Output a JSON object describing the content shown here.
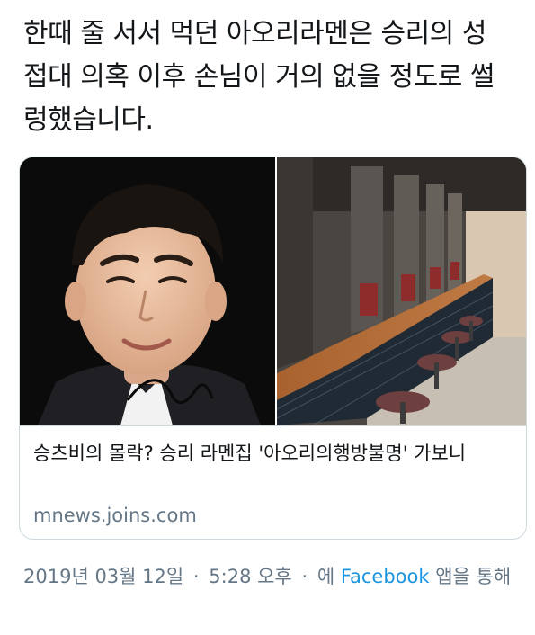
{
  "tweet": {
    "text": "한때 줄 서서 먹던 아오리라멘은 승리의 성 접대 의혹 이후 손님이 거의 없을 정도로 썰렁했습니다."
  },
  "card": {
    "title": "승츠비의 몰락? 승리 라멘집 '아오리의행방불명' 가보니",
    "domain": "mnews.joins.com"
  },
  "meta": {
    "date": "2019년 03월 12일",
    "separator": "·",
    "time": "5:28 오후",
    "via_prefix": "에",
    "source": "Facebook",
    "via_suffix": "앱을 통해"
  },
  "colors": {
    "text": "#14171a",
    "secondary": "#657786",
    "link": "#1b95e0",
    "border": "#cfd9de"
  }
}
